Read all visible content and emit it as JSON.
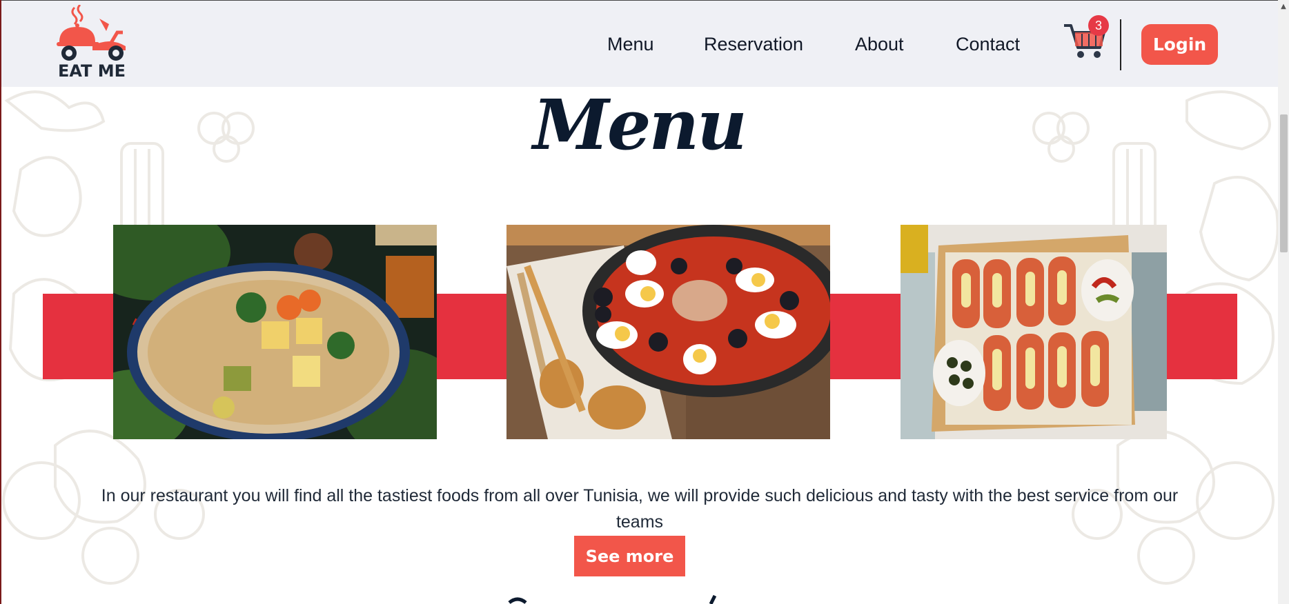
{
  "brand": {
    "name": "EAT ME"
  },
  "nav": {
    "links": [
      {
        "label": "Menu"
      },
      {
        "label": "Reservation"
      },
      {
        "label": "About"
      },
      {
        "label": "Contact"
      }
    ],
    "cart": {
      "icon": "cart-icon",
      "count": "3"
    },
    "login_label": "Login"
  },
  "section": {
    "title": "Menu",
    "dishes": [
      {
        "icon": "couscous-photo"
      },
      {
        "icon": "ojja-egg-dish-photo"
      },
      {
        "icon": "tunisian-sandwiches-photo"
      }
    ],
    "description": "In our restaurant you will find all the tastiest foods from all over Tunisia, we will provide such delicious and tasty with the best service from our teams",
    "see_more_label": "See more"
  },
  "colors": {
    "accent": "#f2564a",
    "band_red": "#e5313f",
    "badge_red": "#e63946",
    "navbar_bg": "#eff0f5",
    "title_navy": "#0c1a2e"
  }
}
